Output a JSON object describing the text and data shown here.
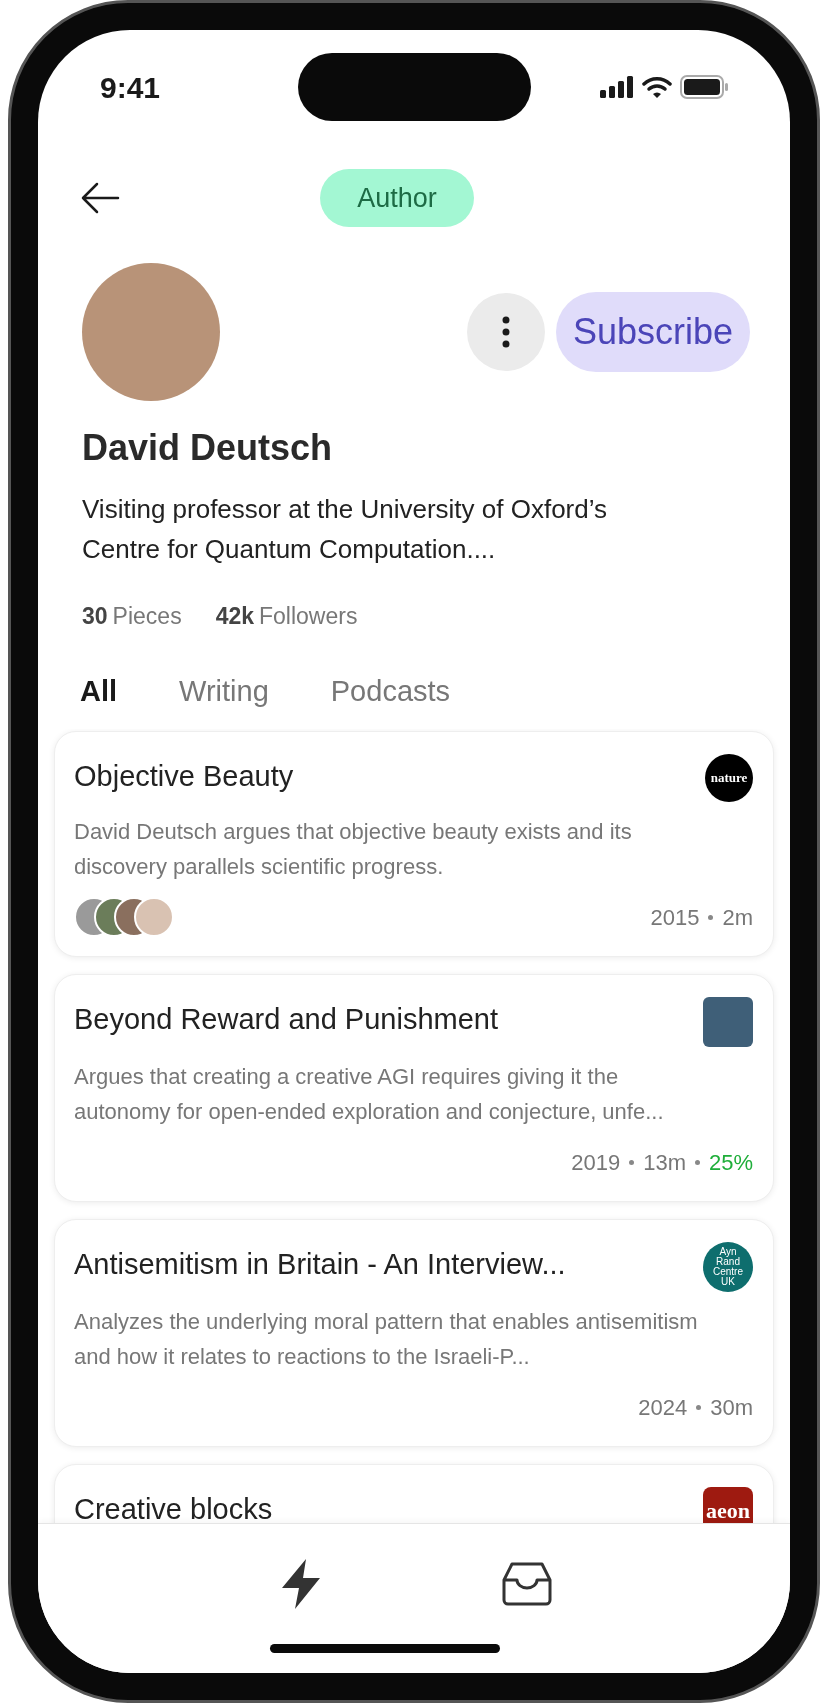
{
  "status_bar": {
    "time": "9:41"
  },
  "header": {
    "badge": "Author"
  },
  "profile": {
    "name": "David Deutsch",
    "subscribe_button": "Subscribe",
    "bio": "Visiting professor at the University of Oxford’s Centre for Quantum Computation....",
    "stats": [
      {
        "count": "30",
        "unit": "Pieces"
      },
      {
        "count": "42k",
        "unit": "Followers"
      }
    ]
  },
  "tabs": [
    {
      "label": "All",
      "selected": true
    },
    {
      "label": "Writing",
      "selected": false
    },
    {
      "label": "Podcasts",
      "selected": false
    }
  ],
  "pieces": [
    {
      "title": "Objective Beauty",
      "summary": "David Deutsch argues that objective beauty exists and its discovery parallels scientific progress.",
      "contributor_avatars": true,
      "meta": [
        "2015",
        "2m"
      ],
      "source": {
        "kind": "round",
        "text": "nature",
        "color": "#000000"
      }
    },
    {
      "title": "Beyond Reward and Punishment",
      "summary": "Argues that creating a creative AGI requires giving it the autonomy for open-ended exploration and conjecture, unfe...",
      "contributor_avatars": false,
      "meta": [
        "2019",
        "13m"
      ],
      "progress": "25%",
      "source": {
        "kind": "cover",
        "color": "#3f5f78"
      }
    },
    {
      "title": "Antisemitism in Britain - An Interview...",
      "summary": "Analyzes the underlying moral pattern that enables antisemitism and how it relates to reactions to the Israeli-P...",
      "contributor_avatars": false,
      "meta": [
        "2024",
        "30m"
      ],
      "source": {
        "kind": "round-small",
        "text": "Ayn Rand Centre UK",
        "color": "#0e6e6e"
      }
    },
    {
      "title": "Creative blocks",
      "source": {
        "kind": "square",
        "text": "aeon",
        "color": "#9e1a10"
      }
    }
  ]
}
